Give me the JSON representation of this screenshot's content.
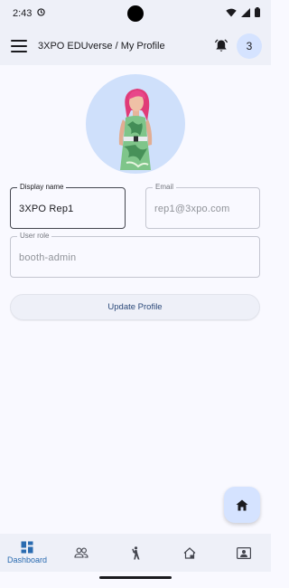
{
  "status_bar": {
    "time": "2:43"
  },
  "app_bar": {
    "title": "3XPO EDUverse / My Profile",
    "badge_count": "3"
  },
  "profile": {
    "display_name_label": "Display name",
    "display_name_value": "3XPO Rep1",
    "email_label": "Email",
    "email_value": "rep1@3xpo.com",
    "role_label": "User role",
    "role_value": "booth-admin",
    "update_label": "Update Profile"
  },
  "bottom_nav": {
    "items": [
      {
        "label": "Dashboard",
        "icon": "dashboard-icon",
        "active": true
      },
      {
        "label": "",
        "icon": "people-icon",
        "active": false
      },
      {
        "label": "",
        "icon": "person-walking-icon",
        "active": false
      },
      {
        "label": "",
        "icon": "home-building-icon",
        "active": false
      },
      {
        "label": "",
        "icon": "contact-card-icon",
        "active": false
      }
    ]
  },
  "colors": {
    "accent": "#2a6bb0",
    "surface": "#eef0f8",
    "avatar_bg": "#cfe0fb",
    "badge_bg": "#d5e3ff"
  }
}
